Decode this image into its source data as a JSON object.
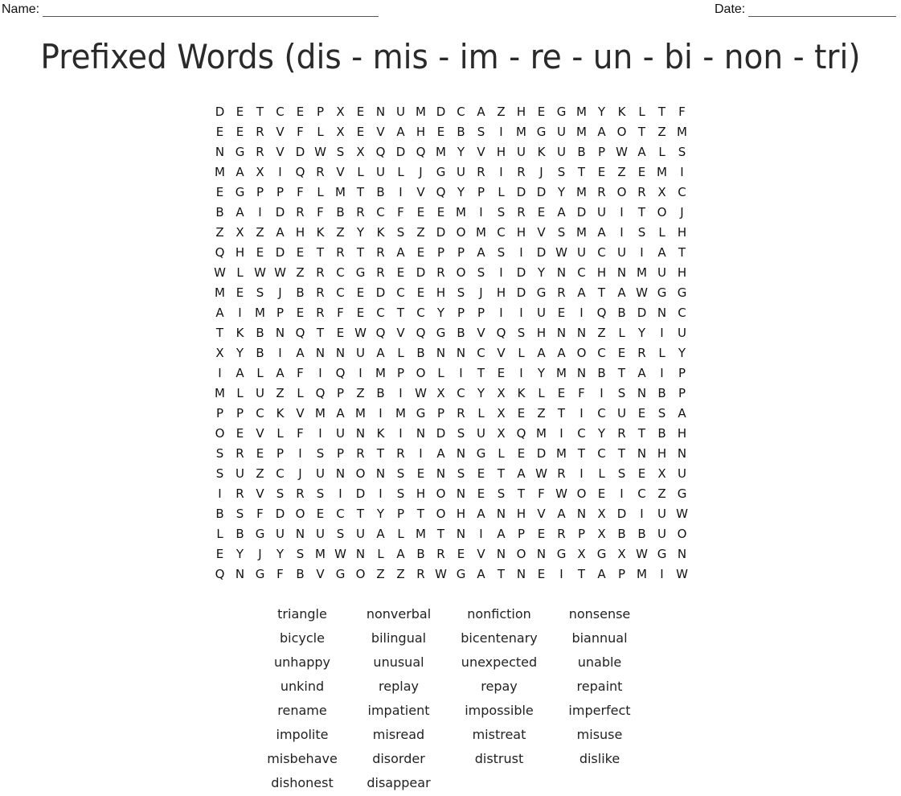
{
  "header": {
    "name_label": "Name:",
    "date_label": "Date:"
  },
  "title": "Prefixed Words (dis - mis - im - re - un - bi - non - tri)",
  "grid": [
    "DETCEPXENUMDCAZHEGMYKLTF",
    "EERVFLXEVAHEBSIMGUMAOTZM",
    "NGRVDWSXQDQMYVHUKUBPWALS",
    "MAXIQRVLULJGURIRJSTEZEMI",
    "EGPPFLMTBIVQYPLDDYMRORXC",
    "BAIDRFBRCFEEMISREADUITOJ",
    "ZXZAHKZYKSZDOMCHVSMAISLH",
    "QHEDETRTRAEPPASIDWUCUIAT",
    "WLWWZRCGREDROSIDYNCHNMUH",
    "MESJBRCEDCEHSJHDGRATAWGG",
    "AIMPERFECTCYPPIIUEIQBDNC",
    "TKBNQTEWQVQGBVQSHNNZLYIU",
    "XYBIANNUALBNNCVLAAOCERLY",
    "IALAFIQIMPOLITEIYMNBTAIP",
    "MLUZLQPZBIWXCYXKLEFISNBP",
    "PPCKVMAMIMGPRLXEZTICUESA",
    "OEVLFIUNKINDSUXQMICYRTBH",
    "SREPISPRTRIANGLEDMTCTNHN",
    "SUZCJUNONSENSETAWRILSEXU",
    "IRVSRSIDISHONESTFWOEICZG",
    "BSFDOECTYPTOHANHVANXDIUW",
    "LBGUNUSUALMTNIAPERPXBBUO",
    "EYJYSMWNLABREVNONGXGXWGN",
    "QNGFBVGOZZRWGATNEITAPMIW"
  ],
  "words": [
    "triangle",
    "nonverbal",
    "nonfiction",
    "nonsense",
    "bicycle",
    "bilingual",
    "bicentenary",
    "biannual",
    "unhappy",
    "unusual",
    "unexpected",
    "unable",
    "unkind",
    "replay",
    "repay",
    "repaint",
    "rename",
    "impatient",
    "impossible",
    "imperfect",
    "impolite",
    "misread",
    "mistreat",
    "misuse",
    "misbehave",
    "disorder",
    "distrust",
    "dislike",
    "dishonest",
    "disappear"
  ]
}
